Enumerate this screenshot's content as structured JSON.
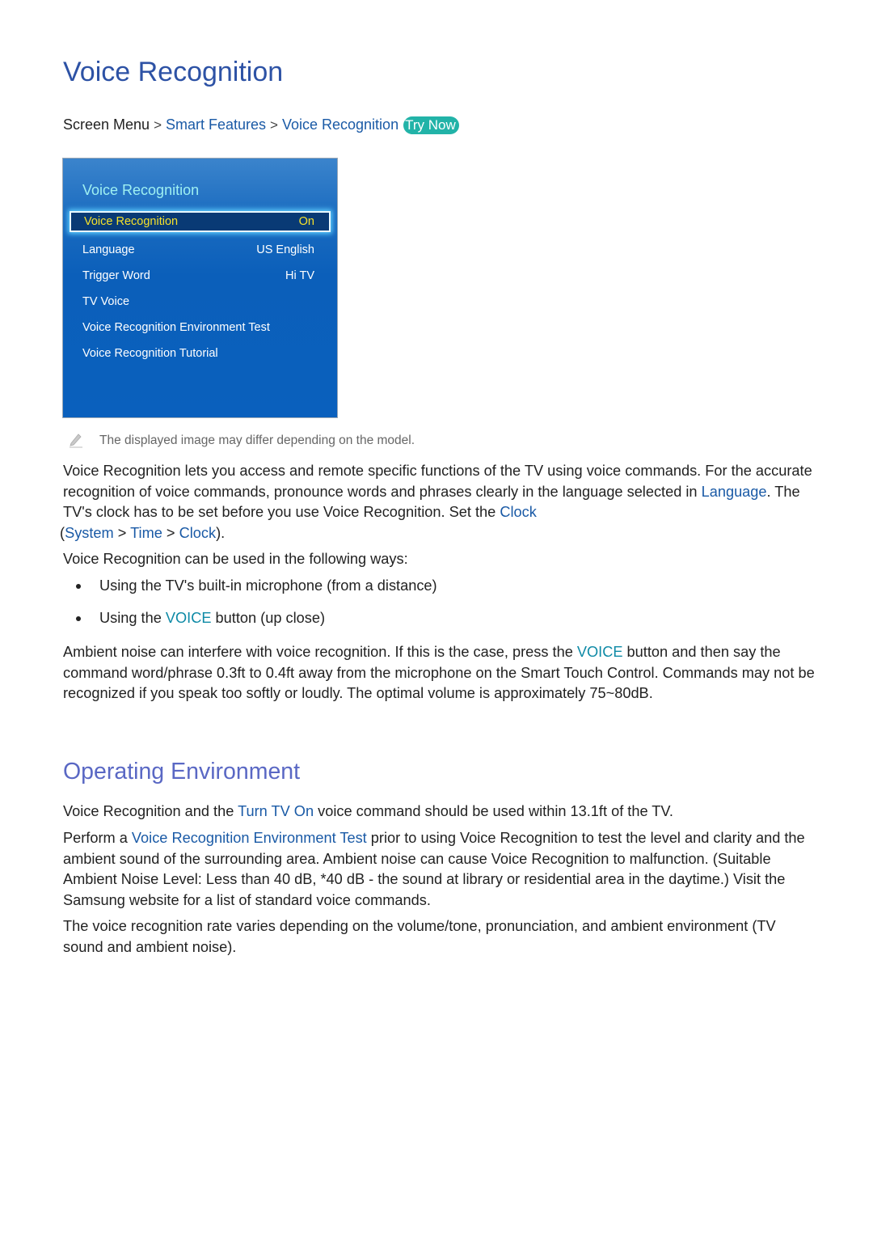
{
  "title": "Voice Recognition",
  "breadcrumb": {
    "items": [
      "Screen Menu",
      "Smart Features",
      "Voice Recognition"
    ],
    "separator": ">",
    "try_now": "Try Now"
  },
  "tv_menu": {
    "title": "Voice Recognition",
    "rows": [
      {
        "label": "Voice Recognition",
        "value": "On",
        "selected": true
      },
      {
        "label": "Language",
        "value": "US English"
      },
      {
        "label": "Trigger Word",
        "value": "Hi TV"
      },
      {
        "label": "TV Voice",
        "value": ""
      },
      {
        "label": "Voice Recognition Environment Test",
        "value": ""
      },
      {
        "label": "Voice Recognition Tutorial",
        "value": ""
      }
    ],
    "colors": {
      "panel": "#0a60bd",
      "title": "#9ef0f2",
      "selected_text": "#f5e12b",
      "selected_bg": "#093a75"
    }
  },
  "note": {
    "icon": "pencil-icon",
    "text": "The displayed image may differ depending on the model."
  },
  "para1": {
    "t1": "Voice Recognition lets you access and remote specific functions of the TV using voice commands. For the accurate recognition of voice commands, pronounce words and phrases clearly in the language selected in ",
    "link1": "Language",
    "t2": ". The TV's clock has to be set before you use Voice Recognition. Set the ",
    "link2": "Clock",
    "t3": " (",
    "link3": "System",
    "sep": " > ",
    "link4": "Time",
    "link5": "Clock",
    "t4": ")."
  },
  "para2": "Voice Recognition can be used in the following ways:",
  "bullets": {
    "b1": "Using the TV's built-in microphone (from a distance)",
    "b2_pre": "Using the ",
    "b2_voice": "VOICE",
    "b2_post": " button (up close)"
  },
  "para3": {
    "t1": "Ambient noise can interfere with voice recognition. If this is the case, press the ",
    "voice": "VOICE",
    "t2": " button and then say the command word/phrase 0.3ft to 0.4ft away from the microphone on the Smart Touch Control. Commands may not be recognized if you speak too softly or loudly. The optimal volume is approximately 75~80dB."
  },
  "section2": {
    "title": "Operating Environment",
    "p1": {
      "t1": "Voice Recognition and the ",
      "link": "Turn TV On",
      "t2": " voice command should be used within 13.1ft of the TV."
    },
    "p2": {
      "t1": "Perform a ",
      "link": "Voice Recognition Environment Test",
      "t2": " prior to using Voice Recognition to test the level and clarity and the ambient sound of the surrounding area. Ambient noise can cause Voice Recognition to malfunction. (Suitable Ambient Noise Level: Less than 40 dB, *40 dB - the sound at library or residential area in the daytime.) Visit the Samsung website for a list of standard voice commands."
    },
    "p3": "The voice recognition rate varies depending on the volume/tone, pronunciation, and ambient environment (TV sound and ambient noise)."
  },
  "colors": {
    "title": "#2d52a5",
    "section_title": "#5a68c4",
    "link": "#1a5aa6",
    "voice_key": "#0e8aa6",
    "try_now_badge": "#22b3a8"
  }
}
